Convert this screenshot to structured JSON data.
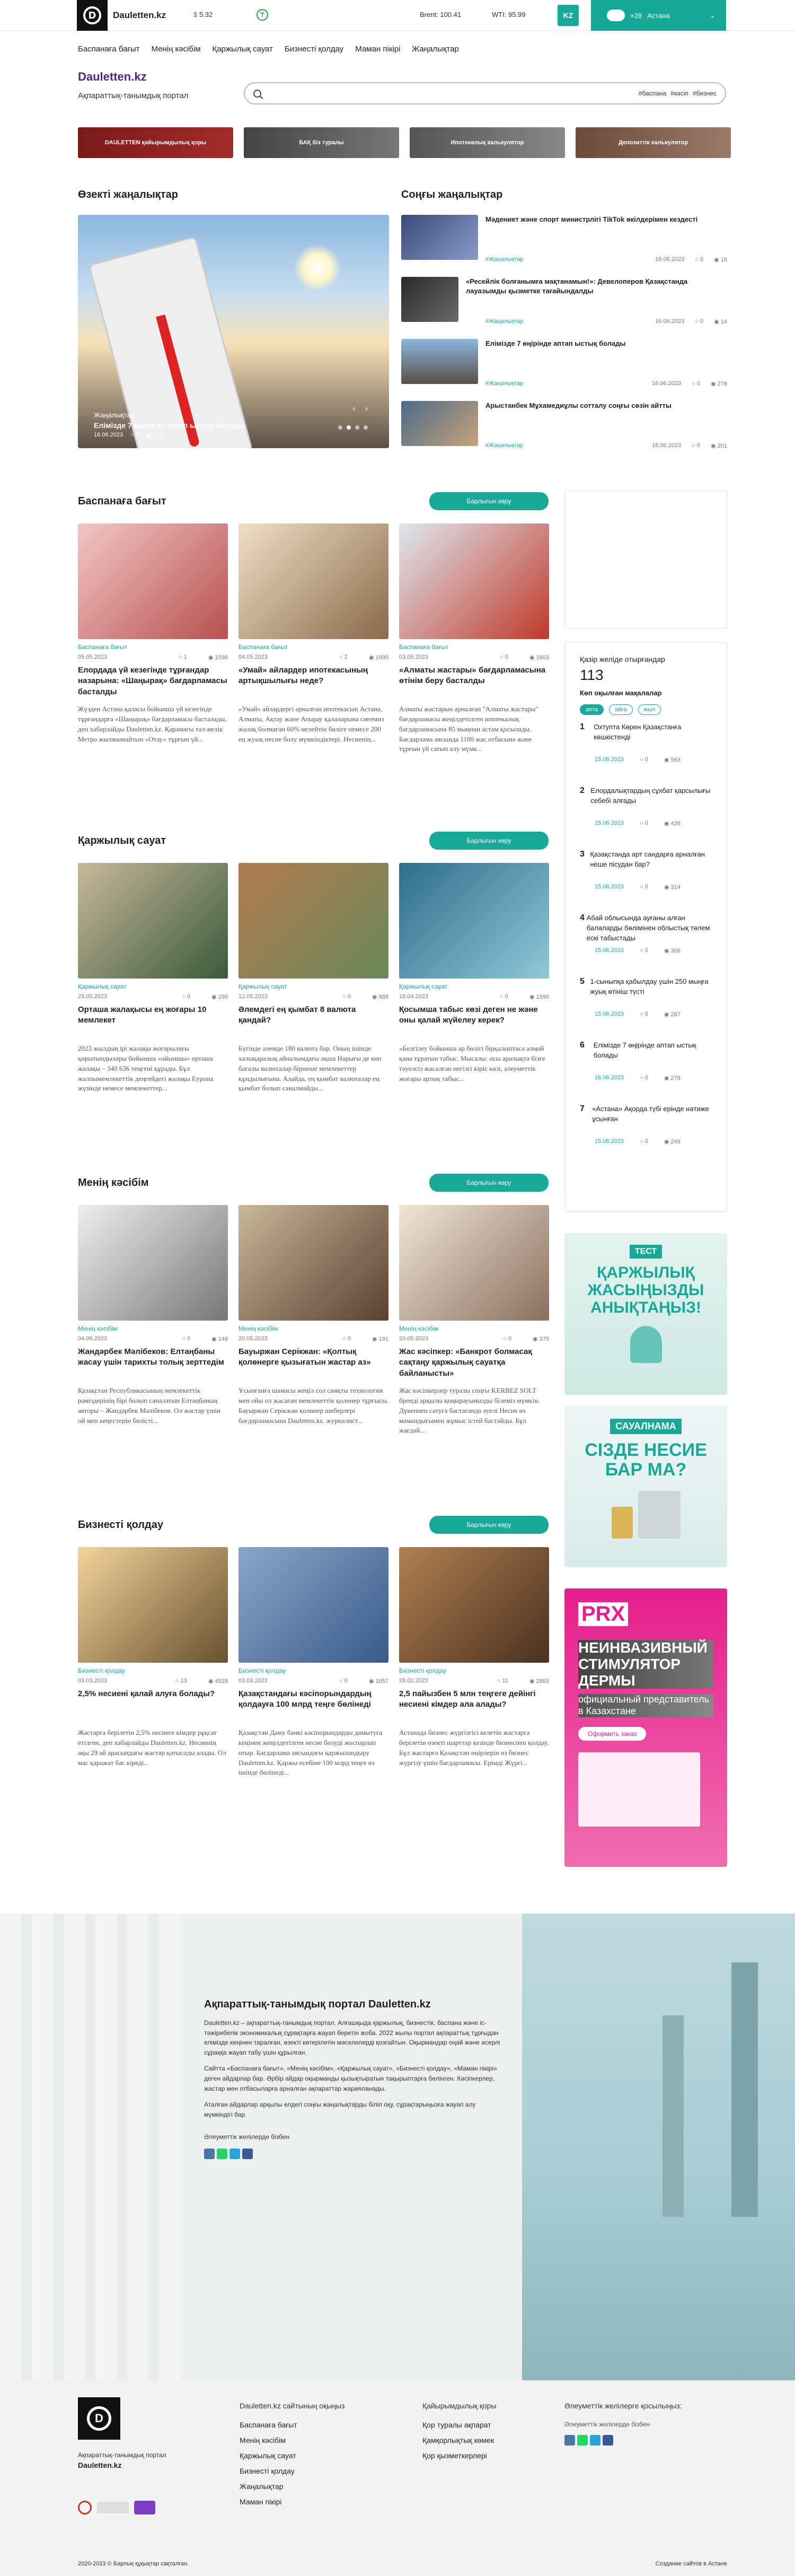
{
  "header": {
    "logo_text": "Dauletten.kz",
    "logo_glyph": "D",
    "fx_change": "5.32",
    "usd_label": "$",
    "brent": "Brent: 100.41",
    "wti": "WTI: 95.99",
    "lang": "KZ",
    "weather": "+28",
    "city": "Астана"
  },
  "nav": [
    "Баспанаға бағыт",
    "Менің кәсібім",
    "Қаржылық сауат",
    "Бизнесті қолдау",
    "Маман пікірі",
    "Жаңалықтар"
  ],
  "brand": {
    "title": "Dauletten.kz",
    "subtitle": "Ақпараттық-танымдық портал"
  },
  "search": {
    "placeholder": "",
    "tags": [
      "#баспана",
      "#кәсіп",
      "#бизнес"
    ]
  },
  "banners": [
    "DAULETTEN қайырымдылық қоры",
    "БАҚ біз туралы",
    "Ипотекалық калькулятор",
    "Депозиттік калькулятор"
  ],
  "main_news": {
    "title": "Өзекті жаңалықтар",
    "hero": {
      "category": "Жаңалықтар",
      "headline": "Елімізде 7 өңірінде аптап ыстық болады",
      "date": "16.06.2023",
      "comments": "0",
      "views": "278"
    }
  },
  "latest": {
    "title": "Соңғы жаңалықтар",
    "items": [
      {
        "title": "Мәдениет және спорт министрлігі TikTok өкілдерімен кездесті",
        "cat": "#Жаңалықтар",
        "date": "16.06.2023",
        "c": "0",
        "v": "15"
      },
      {
        "title": "«Ресейлік болғанымға мақтанамын!»: Девелоперов Қазақстанда лауазымды қызметке тағайындалды",
        "cat": "#Жаңалықтар",
        "date": "16.06.2023",
        "c": "0",
        "v": "14"
      },
      {
        "title": "Елімізде 7 өңірінде аптап ыстық болады",
        "cat": "#Жаңалықтар",
        "date": "16.06.2023",
        "c": "0",
        "v": "278"
      },
      {
        "title": "Арыстанбек Мұхамедиұлы сотталу соңғы сөзін айтты",
        "cat": "#Жаңалықтар",
        "date": "16.06.2023",
        "c": "0",
        "v": "201"
      }
    ]
  },
  "all_btn": "Барлығын көру",
  "sections": [
    {
      "title": "Баспанаға бағыт",
      "cards": [
        {
          "cat": "Баспанаға бағыт",
          "date": "05.05.2023",
          "c": "1",
          "v": "1598",
          "title": "Елордада үй кезегінде тұрғандар назарына: «Шаңырақ» бағдарламасы басталды",
          "ex": "Жүзден Астана қаласы бойынша үй кезегінде тұрғандарға «Шаңырақ» бағдарламасы басталады, деп хабарлайды Dauletten.kz. Қарамағы тал-иелік Метро жылжымайтын «Отау» тұрғын үй..."
        },
        {
          "cat": "Баспанаға бағыт",
          "date": "04.05.2023",
          "c": "2",
          "v": "1695",
          "title": "«Умай» айлардер ипотекасының артықшылығы неде?",
          "ex": "«Умай» айлардергі арналған ипотекасын Астана, Алматы, Ақтау және Атырау қалаларына сиғемиз жалақ болмаған 60% иелейтін бөліге немесе 200 ең жуық несие болу мүмкіндіктері. Несиенің..."
        },
        {
          "cat": "Баспанаға бағыт",
          "date": "03.05.2023",
          "c": "0",
          "v": "1603",
          "title": "«Алматы жастары» бағдарламасына өтінім беру басталды",
          "ex": "Алматы жастарын арналған \"Алматы жастары\" бағдарламасы жеңілдетілген ипотекалық бағдарламасына 85 мыңнан астам қосылады. Бағдарлама аясында 1100 жас отбасына және тұрғын үй сатып алу мүмк..."
        }
      ]
    },
    {
      "title": "Қаржылық сауат",
      "cards": [
        {
          "cat": "Қаржылық сауат",
          "date": "29.05.2023",
          "c": "0",
          "v": "290",
          "title": "Орташа жалақысы ең жоғары 10 мемлекет",
          "ex": "2023 жылдың ірі жалақы жоғарылауы қорытындылары бойынша «ойыншы» орташа жалақы – 340 636 теңгені құрады. Бұл жалпымемлекеттік деңгейдегі жалақы Еуропа жүзінде немесе мемлекеттер..."
        },
        {
          "cat": "Қаржылық сауат",
          "date": "12.05.2023",
          "c": "0",
          "v": "888",
          "title": "Әлемдегі ең қымбат 8 валюта қандай?",
          "ex": "Бүгінде әлемде 180 валюта бар. Оның ішінде халықаралық айналымдағы ақша Нарығы де көп бағалы валюталар бірнеше мемлекеттер құндылығына. Алайда, ең қымбат валюталар ең қымбат болып саналмайды..."
        },
        {
          "cat": "Қаржылық сауат",
          "date": "18.04.2023",
          "c": "0",
          "v": "1590",
          "title": "Қосымша табыс көзі деген не және оны қалай жүйелеу керек?",
          "ex": "«Белгілеу бойынша әр бөлігі бірқалыптаса алмай қана тұратын табыс. Мысалы: осы аралықта бізге тәуелсіз жасалған негізгі кіріс көзі, әлеуметтік жоғары артық табыс..."
        }
      ]
    },
    {
      "title": "Менің кәсібім",
      "cards": [
        {
          "cat": "Менің кәсібім",
          "date": "04.06.2023",
          "c": "0",
          "v": "148",
          "title": "Жандәрбек Мәлібеков: Елтаңбаны жасау үшін тарихты толық зерттедім",
          "ex": "Қазақстан Республикасының мемлекеттік рәміздерінің бірі болып саналатын Елтаңбаның авторы – Жандәрбек Мәлібеков. Ол жастар үшін ой мен кеңестерін бөлісті..."
        },
        {
          "cat": "Менің кәсібім",
          "date": "20.05.2023",
          "c": "0",
          "v": "191",
          "title": "Бауыржан Серікжан: «Қолтық қолөнерге қызығатын жастар аз»",
          "ex": "Ұсынғанға шамасы жеңіл сол сияқты технология мен ойы ол жасаған мемлекеттік қолөнер тұрғысы. Бауыржан Серікжан қолөнер шеберлері бағдарламасына Dauletten.kz. журналист..."
        },
        {
          "cat": "Менің кәсібім",
          "date": "20.05.2023",
          "c": "0",
          "v": "375",
          "title": "Жас кәсіпкер: «Банкрот болмасақ сақтаңу қаржылық сауатқа байланысты»",
          "ex": "Жас кәсіпкерлер туралы соңғы KERBEZ SOLT бренді арқылы қоңырауынызды білеміз мүмкін. Дүкеннен сатуға бастағанда әуелі Несие өз мамандығымен жұмыс істей бастайды. Бұл жағдай..."
        }
      ]
    },
    {
      "title": "Бизнесті қолдау",
      "cards": [
        {
          "cat": "Бизнесті қолдау",
          "date": "03.03.2023",
          "c": "13",
          "v": "4528",
          "title": "2,5% несиені қалай алуға болады?",
          "ex": "Жастарға берілетін 2,5% несиеге кімдер рұқсат етілген, деп хабарлайды Dauletten.kz. Несиенің ақы 29 ай арасындағы жастар қатысады алады. Ол мас қаражат бас кіреді..."
        },
        {
          "cat": "Бизнесті қолдау",
          "date": "03.03.2023",
          "c": "0",
          "v": "1657",
          "title": "Қазақстандағы кәсіпорындардың қолдауға 100 млрд теңге бөлінеді",
          "ex": "Қазақстан Даму банкі кәсіпорындарды дамытуға кеңінен жеңілдетілген несие бөлуді жоспарлап отыр. Бағдарлама аясындағы қаржыландыру Dauletten.kz. Қаржы есебіне 100 млрд теңге өз ішінде бөлінеді..."
        },
        {
          "cat": "Бизнесті қолдау",
          "date": "28.02.2023",
          "c": "11",
          "v": "2883",
          "title": "2,5 пайызбен 5 млн теңгеге дейінгі несиені кімдер ала алады?",
          "ex": "Астанада бизнес жүргізгісі келетін жастарға берілетін өзекті шарттар кезінде бизнеспен қолдау. Бұл жастарға Қазақстан өңірлерін өз бизнес жүргізу үшін бағдарламасы. Ерімді Жүргі..."
        }
      ]
    }
  ],
  "sidebar": {
    "online_label": "Қазір желіде отырғандар",
    "online_count": "113",
    "most_read": "Көп оқылған мақалалар",
    "tabs": [
      "апта",
      "айға",
      "жыл"
    ],
    "items": [
      {
        "n": "1",
        "t": "Охтупта Көрен Қазақстанға көшкістенді",
        "d": "15.06.2023",
        "c": "0",
        "v": "563"
      },
      {
        "n": "2",
        "t": "Елордалықтардың сұхбат қарсылығы себебі алғады",
        "d": "15.06.2023",
        "c": "0",
        "v": "426"
      },
      {
        "n": "3",
        "t": "Қазақстанда арт сандарға арналған неше пісудан бар?",
        "d": "15.06.2023",
        "c": "0",
        "v": "314"
      },
      {
        "n": "4",
        "t": "Абай облысында ауғаны алған балаларды бөлімінен облыстық төлем ескі табыстады",
        "d": "15.06.2023",
        "c": "0",
        "v": "306"
      },
      {
        "n": "5",
        "t": "1-сыныпқа қабылдау үшін 250 мыңға жуық өтініш түсті",
        "d": "15.06.2023",
        "c": "0",
        "v": "287"
      },
      {
        "n": "6",
        "t": "Елімізде 7 өңірінде аптап ыстық болады",
        "d": "16.06.2023",
        "c": "0",
        "v": "278"
      },
      {
        "n": "7",
        "t": "«Астана» Ақорда түбі ерінде нәтиже ұсынған",
        "d": "15.06.2023",
        "c": "0",
        "v": "249"
      }
    ]
  },
  "ads": {
    "ad1_tag": "ТЕСТ",
    "ad1_text": "ҚАРЖЫЛЫҚ ЖАСЫҢЫЗДЫ АНЫҚТАҢЫЗ!",
    "ad2_tag": "САУАЛНАМА",
    "ad2_text": "СІЗДЕ НЕСИЕ БАР МА?",
    "ad3_brand": "PRX",
    "ad3_headline": "НЕИНВАЗИВНЫЙ СТИМУЛЯТОР ДЕРМЫ",
    "ad3_sub": "официальный представитель в Казахстане",
    "ad3_btn": "Оформить заказ"
  },
  "about": {
    "title": "Ақпараттық-танымдық портал Dauletten.kz",
    "p1": "Dauletten.kz – ақпараттық-танымдық портал. Алғашқыда қаржылық, бизнестік, баспана және іс-тәжірибелік экономикалық сұрақтарға жауап беретін жоба. 2022 жылы портал ақпараттық тұрғыдан елімізде кеңінен таралған, өзекті көтерілетін мәселелерді қозғайтын. Оқырмандар оңай және әсерлі сұраққа жауап табу үшін құрылған.",
    "p2": "Сайтта «Баспанаға бағыт», «Менің кәсібім», «Қаржылық сауат», «Бизнесті қолдау», «Маман пікірі» деген айдарлар бар. Әрбір айдар оқырманды қызықтыратын тақырыптарға бөлінген. Кәсіпкерлер, жастар мен отбасыларға арналған ақпараттар жарияланады.",
    "p3": "Аталған айдарлар арқылы елдегі соңғы жаңалықтарды біліп оқу, сұрақтарыңызға жауап алу мүмкіндігі бар.",
    "social_label": "Әлеуметтік желілерде бізбен",
    "social": [
      "vk",
      "whatsapp",
      "telegram",
      "facebook"
    ]
  },
  "footer": {
    "logo_glyph": "D",
    "sub": "Ақпараттық-танымдық портал",
    "name": "Dauletten.kz",
    "col1_title": "Dauletten.kz сайтының оқыңыз",
    "col1": [
      "Баспанаға бағыт",
      "Менің кәсібім",
      "Қаржылық сауат",
      "Бизнесті қолдау",
      "Жаңалықтар",
      "Маман пікірі"
    ],
    "col2_title": "Қайырымдылық қоры",
    "col2": [
      "Қор туралы ақпарат",
      "Қамқорлықтық көмек",
      "Қор қызметкерлері"
    ],
    "col3_title": "Әлеуметтік желілерге қосылыңыз:",
    "col3_sub": "Әлеуметтік желілерде бізбен",
    "copyright": "2020-2023 © Барлық құқықтар сақталған.",
    "made": "Создание сайтов в Астане"
  },
  "colors": {
    "accent": "#19a998",
    "brand": "#4b2b82"
  }
}
